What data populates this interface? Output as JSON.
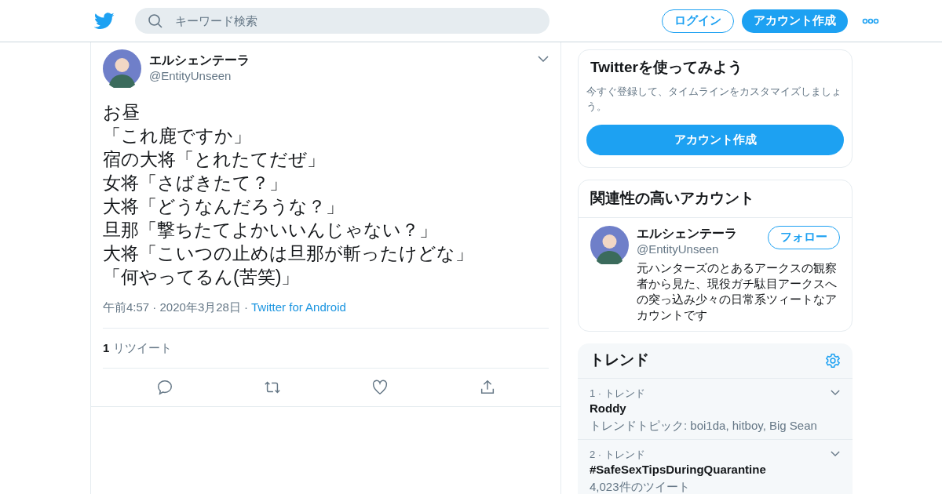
{
  "header": {
    "search": {
      "placeholder": "キーワード検索"
    },
    "buttons": [
      {
        "label": "ログイン",
        "kind": "outline"
      },
      {
        "label": "アカウント作成",
        "kind": "filled"
      }
    ]
  },
  "tweet": {
    "name": "エルシェンテーラ",
    "handle": "@EntityUnseen",
    "lines": [
      "お昼",
      "「これ鹿ですか」",
      "宿の大将「とれたてだぜ」",
      "女将「さばきたて？」",
      "大将「どうなんだろうな？」",
      "旦那「撃ちたてよかいいんじゃない？」",
      "大将「こいつの止めは旦那が斬ったけどな」",
      "「何やってるん(苦笑)」"
    ],
    "time": "午前4:57 · 2020年3月28日",
    "separator": "·",
    "source": "Twitter for Android",
    "retweet_count": "1",
    "retweet_label": "リツイート"
  },
  "signup_card": {
    "title": "Twitterを使ってみよう",
    "text": "今すぐ登録して、タイムラインをカスタマイズしましょう。",
    "button": "アカウント作成"
  },
  "related": {
    "title": "関連性の高いアカウント",
    "accounts": [
      {
        "name": "エルシェンテーラ",
        "handle": "@EntityUnseen",
        "button": "フォロー",
        "bio": "元ハンターズのとあるアークスの観察者から見た、現役ガチ駄目アークスへの突っ込み少々の日常系ツィートなアカウントです"
      }
    ]
  },
  "trends": {
    "title": "トレンド",
    "items": [
      {
        "rank": "1 · トレンド",
        "topic": "Roddy",
        "detail": "トレンドトピック: boi1da, hitboy, Big Sean"
      },
      {
        "rank": "2 · トレンド",
        "topic": "#SafeSexTipsDuringQuarantine",
        "detail": "4,023件のツイート"
      }
    ]
  }
}
